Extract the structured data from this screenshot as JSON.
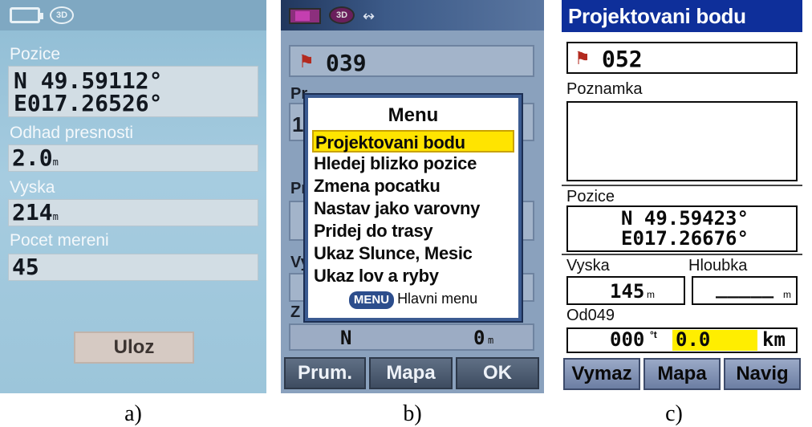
{
  "panel_a": {
    "status": {
      "gps_mode": "3D"
    },
    "pozice": {
      "label": "Pozice",
      "lat": "N  49.59112°",
      "lon": "E017.26526°"
    },
    "presnost": {
      "label": "Odhad presnosti",
      "value": "2.0",
      "unit": "m"
    },
    "vyska": {
      "label": "Vyska",
      "value": "214",
      "unit": "m"
    },
    "mereni": {
      "label": "Pocet mereni",
      "value": "45"
    },
    "save_label": "Uloz",
    "caption": "a)"
  },
  "panel_b": {
    "status": {
      "gps_mode": "3D",
      "signal": "↭"
    },
    "waypoint": "039",
    "ghost_labels": {
      "p1": "Pr",
      "v1": "1",
      "p2": "Pr",
      "v2": "Vy",
      "z1": "Z"
    },
    "bottom": {
      "dir": "N",
      "dist": "0",
      "unit": "m"
    },
    "menu": {
      "title": "Menu",
      "items": [
        "Projektovani bodu",
        "Hledej blizko pozice",
        "Zmena pocatku",
        "Nastav jako varovny",
        "Pridej do trasy",
        "Ukaz Slunce, Mesic",
        "Ukaz lov a ryby"
      ],
      "selected_index": 0,
      "key_label": "MENU",
      "footer": "Hlavni menu"
    },
    "softkeys": [
      "Prum.",
      "Mapa",
      "OK"
    ],
    "caption": "b)"
  },
  "panel_c": {
    "title": "Projektovani bodu",
    "waypoint": "052",
    "poznamka_label": "Poznamka",
    "pozice": {
      "label": "Pozice",
      "lat": "N  49.59423°",
      "lon": "E017.26676°"
    },
    "vyska": {
      "label": "Vyska",
      "value": "145",
      "unit": "m"
    },
    "hloubka": {
      "label": "Hloubka",
      "value": "_____",
      "unit": "m"
    },
    "od": {
      "label": "Od049",
      "bearing": "000",
      "bearing_unit": "°t",
      "distance": "0.0",
      "distance_unit": "km"
    },
    "softkeys": [
      "Vymaz",
      "Mapa",
      "Navig"
    ],
    "colors": {
      "title_bar": "#0e2f9a",
      "highlight": "#ffee00"
    },
    "caption": "c)"
  }
}
